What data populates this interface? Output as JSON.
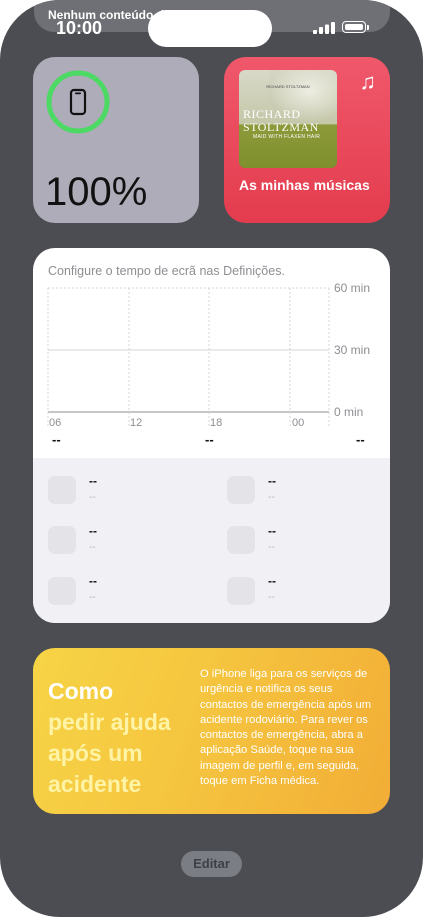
{
  "status_bar": {
    "notification_text": "Nenhum conteúdo disponível",
    "time": "10:00"
  },
  "battery_widget": {
    "percent_label": "100%",
    "level": 1.0,
    "ring_color": "#4cd964",
    "device_icon": "iphone-icon"
  },
  "music_widget": {
    "label": "As minhas músicas",
    "note_icon": "music-note-icon",
    "album": {
      "top_line": "RICHARD STOLTZMAN",
      "artist_line1": "RICHARD",
      "artist_line2": "STOLTZMAN",
      "title": "MAID WITH FLAXEN HAIR"
    }
  },
  "screen_time": {
    "header": "Configure o tempo de ecrã nas Definições.",
    "y_ticks": [
      "60 min",
      "30 min",
      "0 min"
    ],
    "x_ticks": [
      "06",
      "12",
      "18",
      "00"
    ],
    "summary": [
      "--",
      "--",
      "--"
    ],
    "apps": [
      {
        "name": "--",
        "time": "--"
      },
      {
        "name": "--",
        "time": "--"
      },
      {
        "name": "--",
        "time": "--"
      },
      {
        "name": "--",
        "time": "--"
      },
      {
        "name": "--",
        "time": "--"
      },
      {
        "name": "--",
        "time": "--"
      }
    ]
  },
  "tip_widget": {
    "title_line1": "Como",
    "title_line2": "pedir ajuda após um acidente",
    "body": "O iPhone liga para os serviços de urgência e notifica os seus contactos de emergência após um acidente rodoviário. Para rever os contactos de emergência, abra a aplicação Saúde, toque na sua imagem de perfil e, em seguida, toque em Ficha médica."
  },
  "edit_button": {
    "label": "Editar"
  }
}
